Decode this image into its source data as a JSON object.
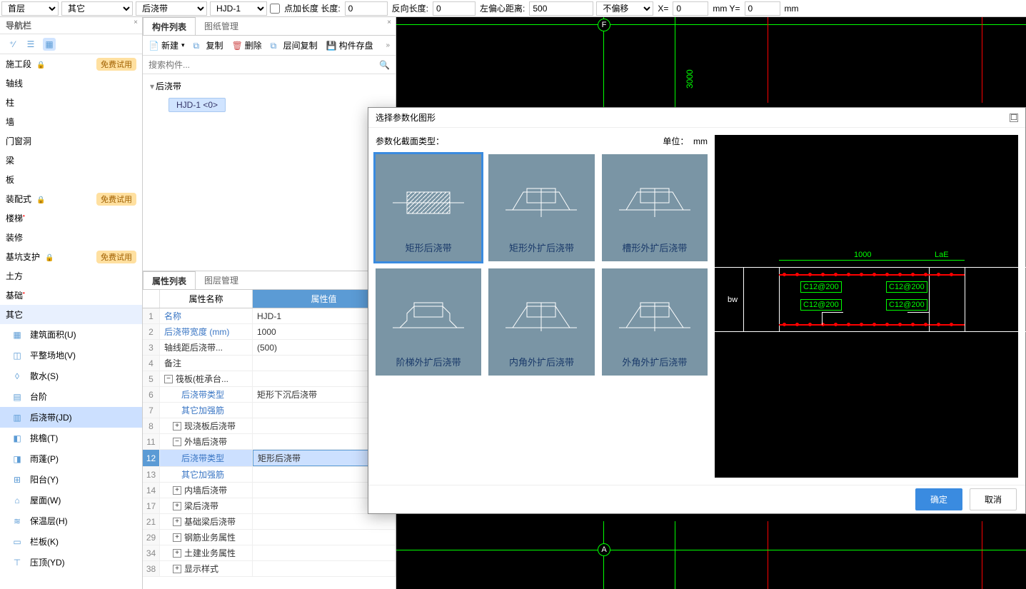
{
  "toolbar": {
    "floor": "首层",
    "category": "其它",
    "component": "后浇带",
    "instance": "HJD-1",
    "pointLenCheck": false,
    "lengthLabel": "点加长度 长度:",
    "length": "0",
    "reverseLabel": "反向长度:",
    "reverse": "0",
    "leftOffsetLabel": "左偏心距离:",
    "leftOffset": "500",
    "offsetMode": "不偏移",
    "xLabel": "X=",
    "x": "0",
    "mmY": "mm Y=",
    "y": "0",
    "mm": "mm"
  },
  "nav": {
    "title": "导航栏",
    "items": [
      {
        "label": "施工段",
        "lock": true,
        "badge": "免费试用"
      },
      {
        "label": "轴线"
      },
      {
        "label": "柱"
      },
      {
        "label": "墙"
      },
      {
        "label": "门窗洞"
      },
      {
        "label": "梁"
      },
      {
        "label": "板"
      },
      {
        "label": "装配式",
        "lock": true,
        "badge": "免费试用"
      },
      {
        "label": "楼梯",
        "dot": true
      },
      {
        "label": "装修"
      },
      {
        "label": "基坑支护",
        "lock": true,
        "badge": "免费试用"
      },
      {
        "label": "土方"
      },
      {
        "label": "基础",
        "dot": true
      },
      {
        "label": "其它",
        "selected": true
      }
    ],
    "subs": [
      {
        "label": "建筑面积(U)"
      },
      {
        "label": "平整场地(V)"
      },
      {
        "label": "散水(S)"
      },
      {
        "label": "台阶"
      },
      {
        "label": "后浇带(JD)",
        "selected": true
      },
      {
        "label": "挑檐(T)"
      },
      {
        "label": "雨蓬(P)"
      },
      {
        "label": "阳台(Y)"
      },
      {
        "label": "屋面(W)"
      },
      {
        "label": "保温层(H)"
      },
      {
        "label": "栏板(K)"
      },
      {
        "label": "压顶(YD)"
      }
    ]
  },
  "comp": {
    "tabs": [
      "构件列表",
      "图纸管理"
    ],
    "activeTab": 0,
    "tools": {
      "new": "新建",
      "copy": "复制",
      "del": "删除",
      "layerCopy": "层间复制",
      "save": "构件存盘"
    },
    "searchPlaceholder": "搜索构件...",
    "treeRoot": "后浇带",
    "treeLeaf": "HJD-1  <0>"
  },
  "props": {
    "tabs": [
      "属性列表",
      "图层管理"
    ],
    "header": {
      "name": "属性名称",
      "value": "属性值"
    },
    "rows": [
      {
        "n": "1",
        "name": "名称",
        "blue": true,
        "val": "HJD-1"
      },
      {
        "n": "2",
        "name": "后浇带宽度 (mm)",
        "blue": true,
        "val": "1000"
      },
      {
        "n": "3",
        "name": "轴线距后浇带...",
        "val": "(500)"
      },
      {
        "n": "4",
        "name": "备注",
        "val": ""
      },
      {
        "n": "5",
        "name": "筏板(桩承台...",
        "exp": "−",
        "val": ""
      },
      {
        "n": "6",
        "name": "后浇带类型",
        "blue": true,
        "indent": 2,
        "val": "矩形下沉后浇带"
      },
      {
        "n": "7",
        "name": "其它加强筋",
        "blue": true,
        "indent": 2,
        "val": ""
      },
      {
        "n": "8",
        "name": "现浇板后浇带",
        "exp": "+",
        "indent": 1,
        "val": ""
      },
      {
        "n": "11",
        "name": "外墙后浇带",
        "exp": "−",
        "indent": 1,
        "val": ""
      },
      {
        "n": "12",
        "name": "后浇带类型",
        "blue": true,
        "indent": 2,
        "val": "矩形后浇带",
        "sel": true,
        "btn": true
      },
      {
        "n": "13",
        "name": "其它加强筋",
        "blue": true,
        "indent": 2,
        "val": ""
      },
      {
        "n": "14",
        "name": "内墙后浇带",
        "exp": "+",
        "indent": 1,
        "val": ""
      },
      {
        "n": "17",
        "name": "梁后浇带",
        "exp": "+",
        "indent": 1,
        "val": ""
      },
      {
        "n": "21",
        "name": "基础梁后浇带",
        "exp": "+",
        "indent": 1,
        "val": ""
      },
      {
        "n": "29",
        "name": "钢筋业务属性",
        "exp": "+",
        "indent": 1,
        "val": ""
      },
      {
        "n": "34",
        "name": "土建业务属性",
        "exp": "+",
        "indent": 1,
        "val": ""
      },
      {
        "n": "38",
        "name": "显示样式",
        "exp": "+",
        "indent": 1,
        "val": ""
      }
    ]
  },
  "canvas": {
    "axisFLabel": "F",
    "axisALabel": "A",
    "dim3000": "3000"
  },
  "dialog": {
    "title": "选择参数化图形",
    "sectionTypeLabel": "参数化截面类型：",
    "unitLabel": "单位：",
    "unit": "mm",
    "shapes": [
      "矩形后浇带",
      "矩形外扩后浇带",
      "槽形外扩后浇带",
      "阶梯外扩后浇带",
      "内角外扩后浇带",
      "外角外扩后浇带"
    ],
    "preview": {
      "width": "1000",
      "laE": "LaE",
      "bw": "bw",
      "rebar1": "C12@200",
      "rebar2": "C12@200",
      "rebar3": "C12@200",
      "rebar4": "C12@200"
    },
    "ok": "确定",
    "cancel": "取消"
  }
}
